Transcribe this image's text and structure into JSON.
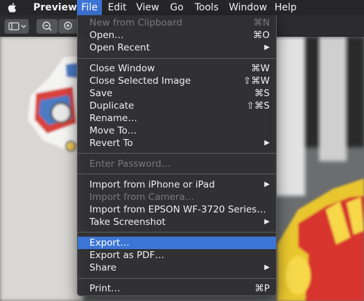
{
  "menubar": {
    "app_name": "Preview",
    "items": [
      {
        "label": "File"
      },
      {
        "label": "Edit"
      },
      {
        "label": "View"
      },
      {
        "label": "Go"
      },
      {
        "label": "Tools"
      },
      {
        "label": "Window"
      },
      {
        "label": "Help"
      }
    ],
    "active_item": "File"
  },
  "toolbar": {
    "sidebar_icon": "sidebar-icon",
    "zoom_out_icon": "zoom-out-icon",
    "zoom_in_icon": "zoom-in-icon"
  },
  "file_menu": {
    "items": [
      {
        "label": "New from Clipboard",
        "shortcut": "⌘N",
        "enabled": false
      },
      {
        "label": "Open…",
        "shortcut": "⌘O",
        "enabled": true
      },
      {
        "label": "Open Recent",
        "submenu_indicator": "▶",
        "enabled": true
      },
      {
        "label": "Close Window",
        "shortcut": "⌘W",
        "enabled": true
      },
      {
        "label": "Close Selected Image",
        "shortcut": "⇧⌘W",
        "enabled": true
      },
      {
        "label": "Save",
        "shortcut": "⌘S",
        "enabled": true
      },
      {
        "label": "Duplicate",
        "shortcut": "⇧⌘S",
        "enabled": true
      },
      {
        "label": "Rename…",
        "enabled": true
      },
      {
        "label": "Move To…",
        "enabled": true
      },
      {
        "label": "Revert To",
        "submenu_indicator": "▶",
        "enabled": true
      },
      {
        "label": "Enter Password…",
        "enabled": false
      },
      {
        "label": "Import from iPhone or iPad",
        "submenu_indicator": "▶",
        "enabled": true
      },
      {
        "label": "Import from Camera…",
        "enabled": false
      },
      {
        "label": "Import from EPSON WF-3720 Series…",
        "enabled": true
      },
      {
        "label": "Take Screenshot",
        "submenu_indicator": "▶",
        "enabled": true
      },
      {
        "label": "Export…",
        "enabled": true,
        "highlighted": true
      },
      {
        "label": "Export as PDF…",
        "enabled": true
      },
      {
        "label": "Share",
        "submenu_indicator": "▶",
        "enabled": true
      },
      {
        "label": "Print…",
        "shortcut": "⌘P",
        "enabled": true
      }
    ]
  },
  "colors": {
    "menubar_bg": "#262628",
    "menu_bg": "#303032",
    "highlight": "#3d75d6",
    "disabled_text": "#7a7a7c"
  }
}
